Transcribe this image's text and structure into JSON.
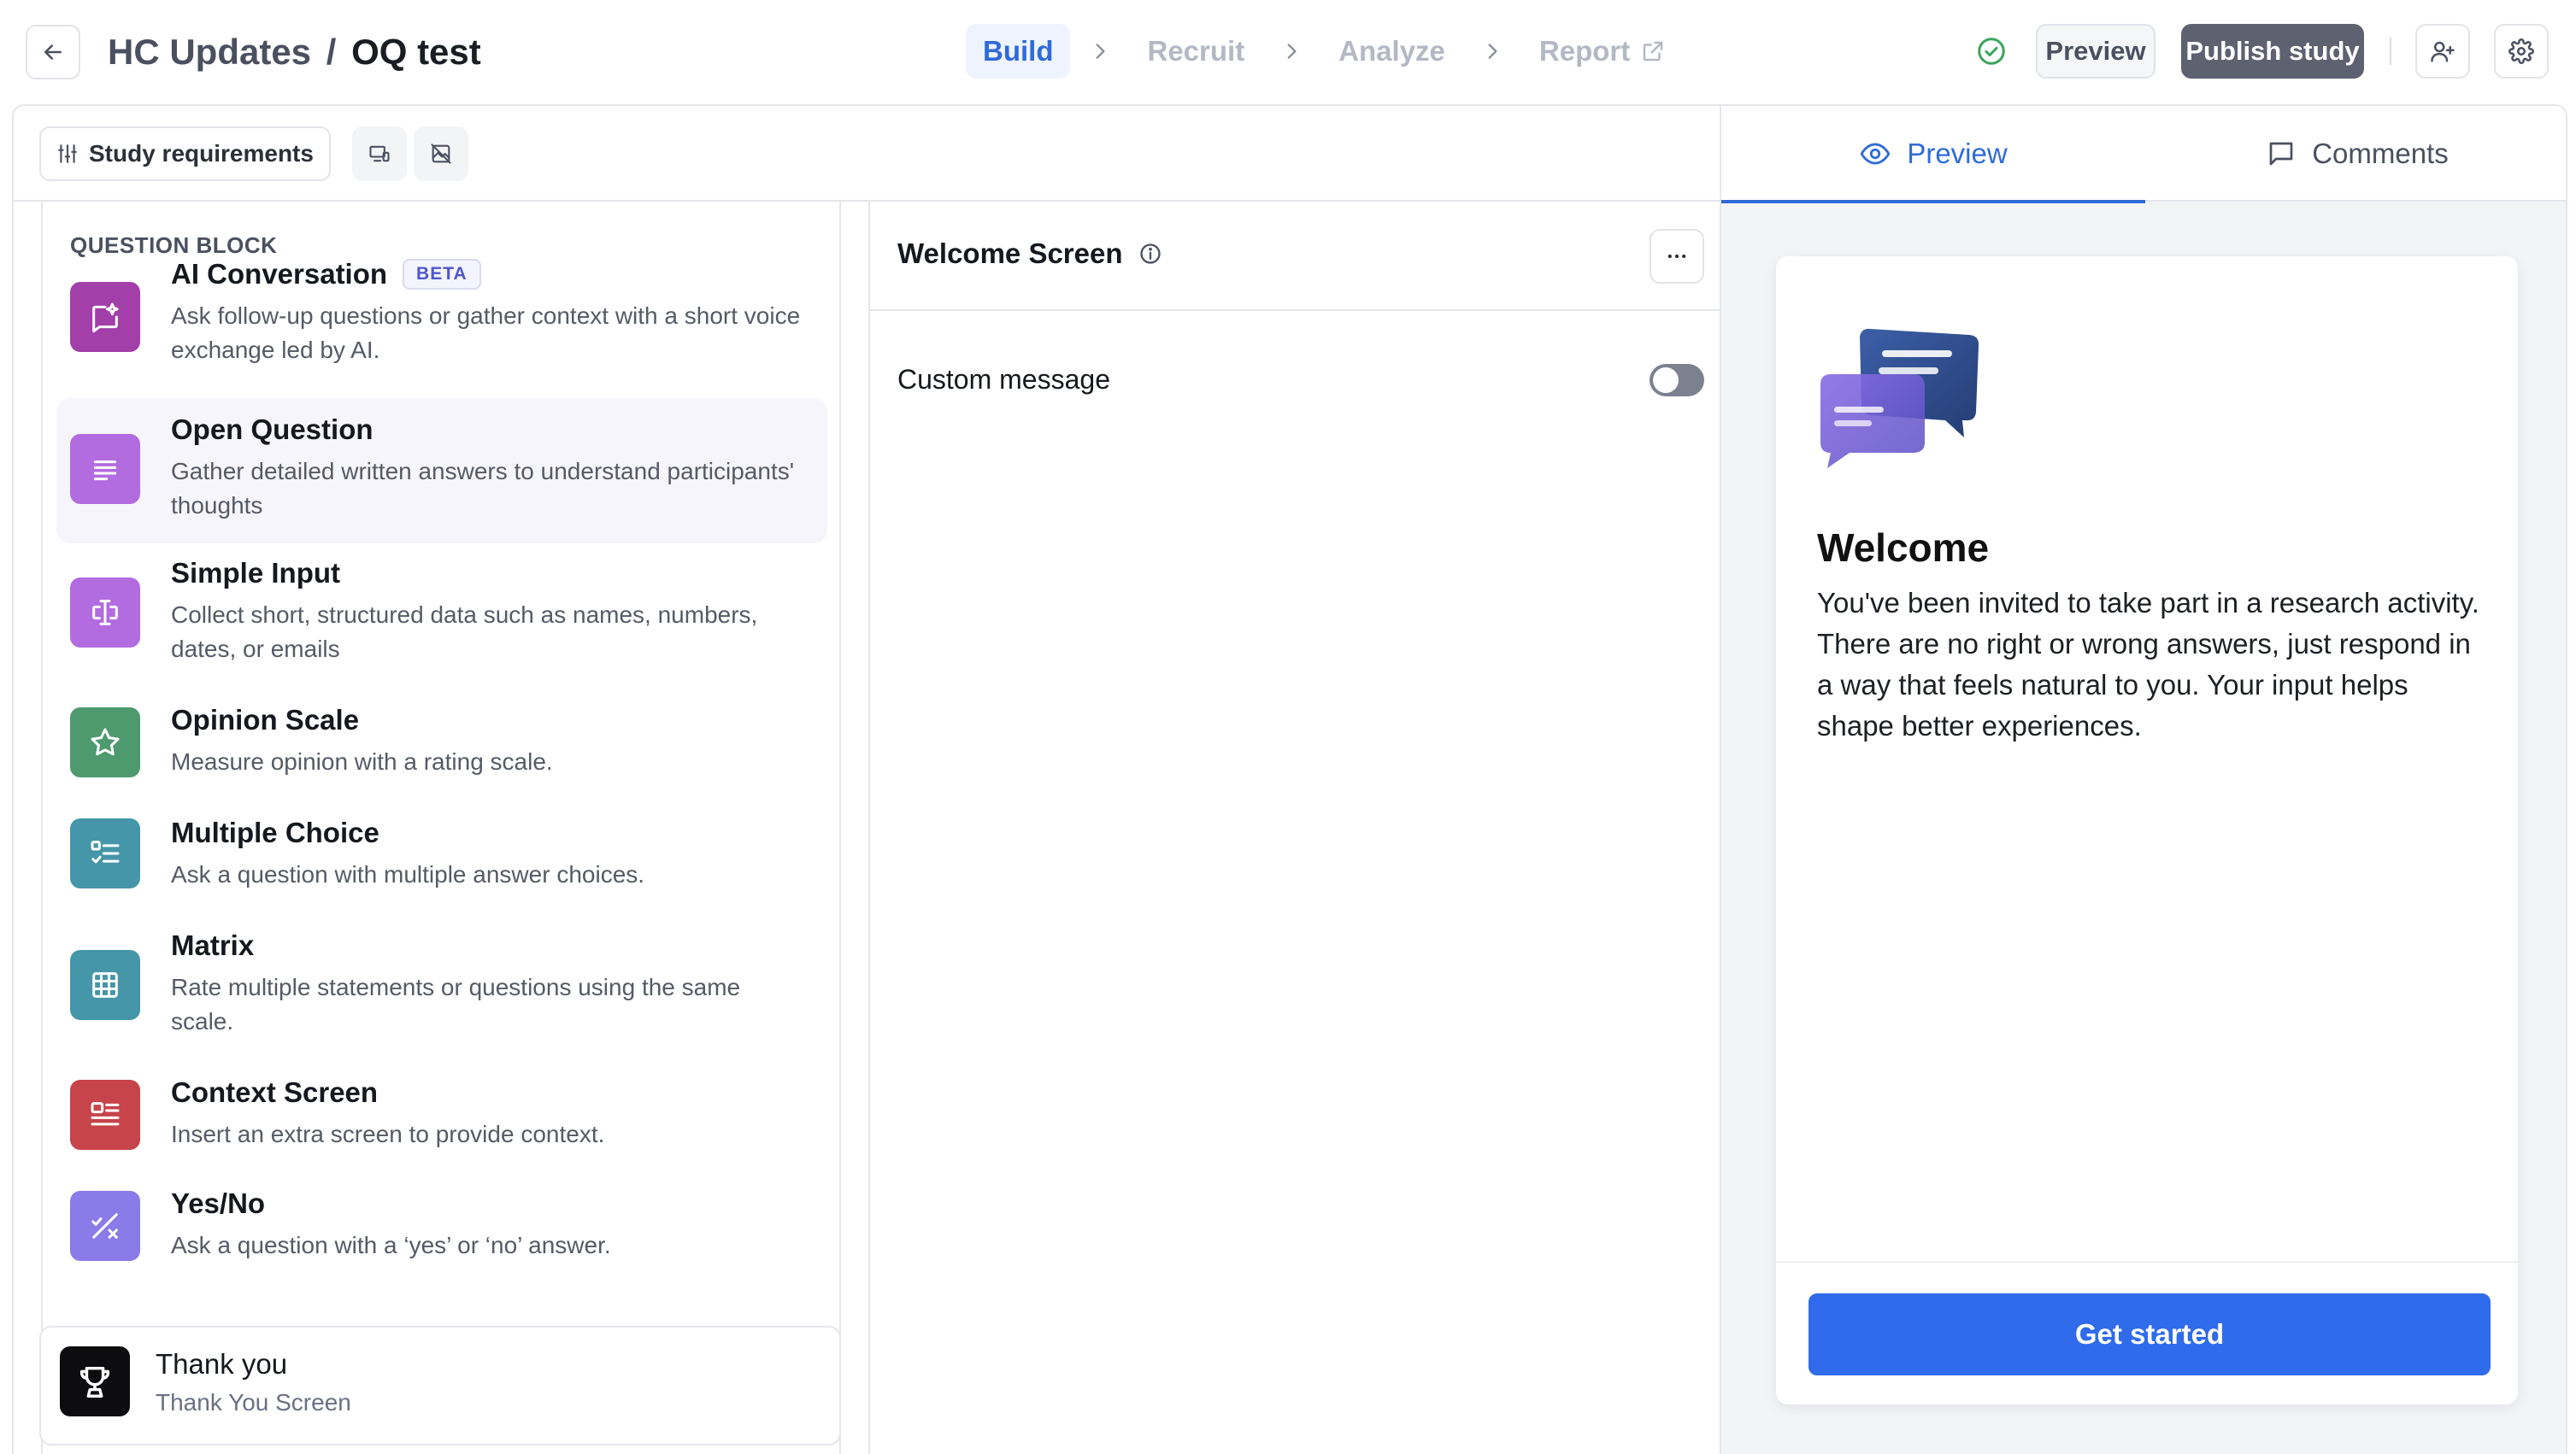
{
  "header": {
    "project": "HC Updates",
    "separator": "/",
    "study": "OQ test",
    "steps": [
      {
        "label": "Build"
      },
      {
        "label": "Recruit"
      },
      {
        "label": "Analyze"
      },
      {
        "label": "Report"
      }
    ],
    "preview_label": "Preview",
    "publish_label": "Publish study"
  },
  "toolbar": {
    "requirements_label": "Study requirements"
  },
  "question_block": {
    "heading": "QUESTION BLOCK",
    "items": [
      {
        "title": "AI Conversation",
        "badge": "BETA",
        "desc": "Ask follow-up questions or gather context with a short voice exchange led by AI.",
        "icon": "ai-sparkle-icon",
        "color": "#a23fa8"
      },
      {
        "title": "Open Question",
        "desc": "Gather detailed written answers to understand participants' thoughts",
        "icon": "text-lines-icon",
        "color": "#b36be0"
      },
      {
        "title": "Simple Input",
        "desc": "Collect short, structured data such as names, numbers, dates, or emails",
        "icon": "text-cursor-icon",
        "color": "#b36be0"
      },
      {
        "title": "Opinion Scale",
        "desc": "Measure opinion with a rating scale.",
        "icon": "star-icon",
        "color": "#4e9a6e"
      },
      {
        "title": "Multiple Choice",
        "desc": "Ask a question with multiple answer choices.",
        "icon": "checklist-icon",
        "color": "#4596a8"
      },
      {
        "title": "Matrix",
        "desc": "Rate multiple statements or questions using the same scale.",
        "icon": "grid-icon",
        "color": "#4596a8"
      },
      {
        "title": "Context Screen",
        "desc": "Insert an extra screen to provide context.",
        "icon": "context-icon",
        "color": "#c7444a"
      },
      {
        "title": "Yes/No",
        "desc": "Ask a question with a ‘yes’ or ‘no’ answer.",
        "icon": "yes-no-icon",
        "color": "#8a7be8"
      }
    ],
    "thank_you": {
      "title": "Thank you",
      "subtitle": "Thank You Screen",
      "icon": "trophy-icon"
    }
  },
  "editor": {
    "title": "Welcome Screen",
    "custom_message_label": "Custom message",
    "custom_message_enabled": false
  },
  "preview_panel": {
    "tabs": [
      {
        "label": "Preview",
        "active": true
      },
      {
        "label": "Comments",
        "active": false
      }
    ],
    "card": {
      "title": "Welcome",
      "body": "You've been invited to take part in a research activity. There are no right or wrong answers, just respond in a way that feels natural to you. Your input helps shape better experiences.",
      "cta": "Get started"
    }
  },
  "colors": {
    "accent": "#2f6bd8",
    "cta": "#2f6bea",
    "publish": "#5e6170",
    "success": "#3aa55b"
  }
}
